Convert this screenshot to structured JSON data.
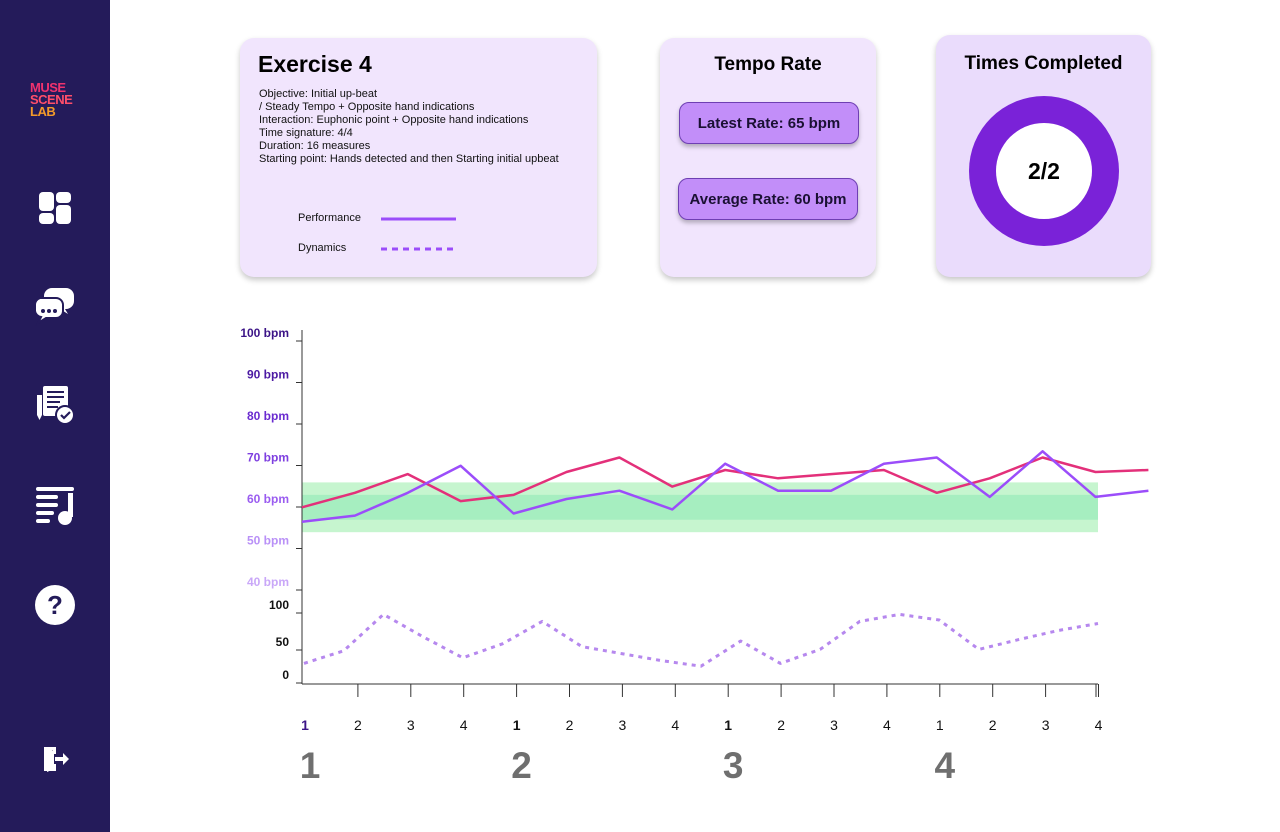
{
  "sidebar": {
    "logo": [
      "MUSE",
      "SCENE",
      "LAB"
    ],
    "items": [
      {
        "name": "dashboard"
      },
      {
        "name": "chat"
      },
      {
        "name": "exercises"
      },
      {
        "name": "music-list"
      },
      {
        "name": "help"
      }
    ],
    "logout": "logout"
  },
  "exercise": {
    "title": "Exercise 4",
    "lines": [
      "Objective: Initial up-beat",
      "/ Steady Tempo + Opposite hand indications",
      "Interaction: Euphonic point + Opposite hand indications",
      "Time signature: 4/4",
      "Duration: 16 measures",
      "Starting point: Hands detected and then Starting initial upbeat"
    ],
    "legend": [
      {
        "label": "Performance",
        "style": "solid",
        "color": "#9b4dfa"
      },
      {
        "label": "Dynamics",
        "style": "dashed",
        "color": "#9b4dfa"
      }
    ]
  },
  "tempo": {
    "title": "Tempo Rate",
    "latest": "Latest Rate: 65 bpm",
    "average": "Average Rate: 60 bpm"
  },
  "completed": {
    "title": "Times Completed",
    "value": "2/2"
  },
  "chart_data": {
    "type": "line",
    "tempo_axis": {
      "ticks": [
        {
          "label": "100 bpm",
          "value": 100,
          "color": "#3c1487"
        },
        {
          "label": "90 bpm",
          "value": 90,
          "color": "#4c1aa3"
        },
        {
          "label": "80 bpm",
          "value": 80,
          "color": "#6a2bd0"
        },
        {
          "label": "70 bpm",
          "value": 70,
          "color": "#7e3fe0"
        },
        {
          "label": "60 bpm",
          "value": 60,
          "color": "#9a5cf0"
        },
        {
          "label": "50 bpm",
          "value": 50,
          "color": "#b990f7"
        },
        {
          "label": "40 bpm",
          "value": 40,
          "color": "#c9a7f8"
        }
      ],
      "range": [
        40,
        100
      ]
    },
    "dynamics_axis": {
      "ticks": [
        {
          "label": "100",
          "value": 100
        },
        {
          "label": "50",
          "value": 50
        },
        {
          "label": "0",
          "value": 0
        }
      ],
      "range": [
        0,
        100
      ]
    },
    "target_band": {
      "outer": [
        52,
        64
      ],
      "inner": [
        55,
        61
      ],
      "outer_color": "#c6f5cf",
      "inner_color": "#a6eec0"
    },
    "x": [
      0,
      1,
      2,
      3,
      4,
      5,
      6,
      7,
      8,
      9,
      10,
      11,
      12,
      13,
      14,
      15
    ],
    "beat_labels": [
      "1",
      "2",
      "3",
      "4",
      "1",
      "2",
      "3",
      "4",
      "1",
      "2",
      "3",
      "4",
      "1",
      "2",
      "3",
      "4"
    ],
    "measure_labels": [
      {
        "label": "1",
        "x": 0
      },
      {
        "label": "2",
        "x": 4
      },
      {
        "label": "3",
        "x": 8
      },
      {
        "label": "4",
        "x": 12
      }
    ],
    "series": [
      {
        "style": "solid",
        "color": "#e3307a",
        "axis": "tempo",
        "points": [
          [
            0,
            58
          ],
          [
            1,
            61.5
          ],
          [
            2,
            66
          ],
          [
            3,
            59.5
          ],
          [
            4,
            61
          ],
          [
            5,
            66.5
          ],
          [
            6,
            70
          ],
          [
            7,
            63
          ],
          [
            8,
            67
          ],
          [
            9,
            65
          ],
          [
            10,
            66
          ],
          [
            11,
            67
          ],
          [
            12,
            61.5
          ],
          [
            13,
            65
          ],
          [
            14,
            70
          ],
          [
            15,
            66.5
          ],
          [
            16,
            67
          ]
        ]
      },
      {
        "style": "solid",
        "color": "#9b4dfa",
        "axis": "tempo",
        "points": [
          [
            0,
            54.5
          ],
          [
            1,
            56
          ],
          [
            2,
            61.5
          ],
          [
            3,
            68
          ],
          [
            4,
            56.5
          ],
          [
            5,
            60
          ],
          [
            6,
            62
          ],
          [
            7,
            57.5
          ],
          [
            8,
            68.5
          ],
          [
            9,
            62
          ],
          [
            10,
            62
          ],
          [
            11,
            68.5
          ],
          [
            12,
            70
          ],
          [
            13,
            60.5
          ],
          [
            14,
            71.5
          ],
          [
            15,
            60.5
          ],
          [
            16,
            62
          ]
        ]
      },
      {
        "style": "dashed",
        "color": "#b688ee",
        "axis": "dynamics",
        "points": [
          [
            0,
            18
          ],
          [
            1,
            36
          ],
          [
            2,
            88
          ],
          [
            3,
            56
          ],
          [
            4,
            26
          ],
          [
            5,
            46
          ],
          [
            6,
            78
          ],
          [
            7,
            42
          ],
          [
            8,
            32
          ],
          [
            9,
            22
          ],
          [
            10,
            14
          ],
          [
            11,
            50
          ],
          [
            12,
            18
          ],
          [
            13,
            38
          ],
          [
            14,
            78
          ],
          [
            15,
            88
          ],
          [
            16,
            80
          ],
          [
            17,
            38
          ],
          [
            18,
            52
          ],
          [
            19,
            65
          ],
          [
            20,
            75
          ]
        ]
      }
    ]
  }
}
